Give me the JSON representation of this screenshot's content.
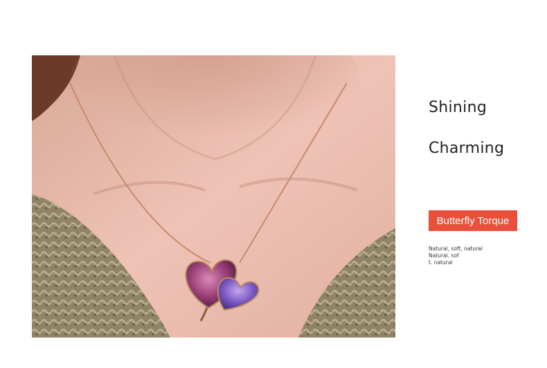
{
  "headline": {
    "line1": "Shining",
    "line2": "Charming"
  },
  "badge": {
    "label": "Butterfly Torque"
  },
  "description": {
    "lines": [
      "Natural, soft, natural",
      "Natural, sof",
      "t. natural"
    ]
  },
  "colors": {
    "badge": "#e8503c",
    "text": "#222222",
    "chain": "#c88a6a"
  }
}
